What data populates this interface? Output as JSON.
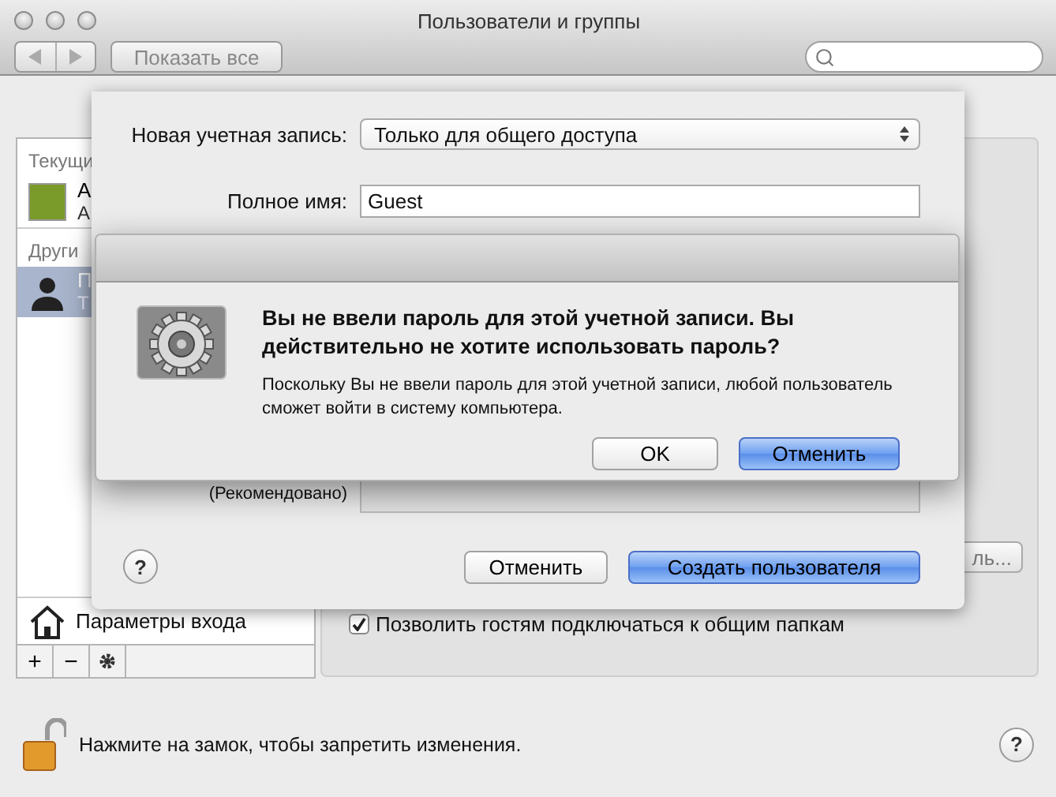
{
  "window": {
    "title": "Пользователи и группы"
  },
  "toolbar": {
    "show_all": "Показать все"
  },
  "sidebar": {
    "sections": [
      {
        "header": "Текущи",
        "users": [
          {
            "name": "А",
            "role": "А",
            "kind": "photo",
            "selected": false
          }
        ]
      },
      {
        "header": "Други",
        "users": [
          {
            "name": "П",
            "role": "Т",
            "kind": "silhouette",
            "selected": true
          }
        ]
      }
    ],
    "login_options": "Параметры входа",
    "buttons": [
      "+",
      "−"
    ]
  },
  "settings_panel": {
    "partial_button": "ль...",
    "guest_checkbox": {
      "label": "Позволить гостям подключаться к общим папкам",
      "checked": true
    }
  },
  "lock": {
    "text": "Нажмите на замок, чтобы запретить изменения.",
    "locked": false,
    "help": "?"
  },
  "sheet": {
    "account_type": {
      "label": "Новая учетная запись:",
      "value": "Только для общего доступа"
    },
    "full_name": {
      "label": "Полное имя:",
      "value": "Guest"
    },
    "hint": "(Рекомендовано)",
    "help": "?",
    "buttons": [
      {
        "label": "Отменить",
        "default": false
      },
      {
        "label": "Создать пользователя",
        "default": true
      }
    ]
  },
  "alert": {
    "title": "Вы не ввели пароль для этой учетной записи. Вы действительно не хотите использовать пароль?",
    "message": "Поскольку Вы не ввели пароль для этой учетной записи, любой пользователь сможет войти в систему компьютера.",
    "buttons": [
      {
        "label": "OK",
        "default": false
      },
      {
        "label": "Отменить",
        "default": true
      }
    ]
  }
}
